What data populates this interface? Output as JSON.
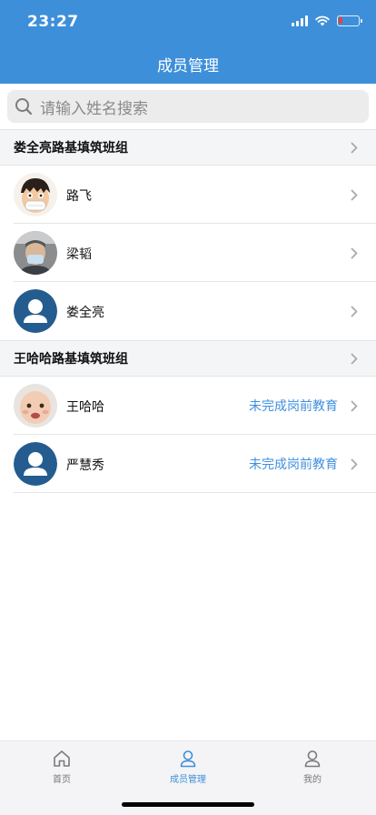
{
  "status_bar": {
    "time": "23:27",
    "battery_level": 0.15,
    "battery_color": "#e4453a"
  },
  "header": {
    "title": "成员管理",
    "background": "#3d8fd9"
  },
  "search": {
    "placeholder": "请输入姓名搜索",
    "icon": "search-icon"
  },
  "groups": [
    {
      "title": "娄全亮路基填筑班组",
      "members": [
        {
          "name": "路飞",
          "avatar": "cartoon-face",
          "status": ""
        },
        {
          "name": "梁韬",
          "avatar": "masked-person-photo",
          "status": ""
        },
        {
          "name": "娄全亮",
          "avatar": "default-avatar",
          "status": ""
        }
      ]
    },
    {
      "title": "王哈哈路基填筑班组",
      "members": [
        {
          "name": "王哈哈",
          "avatar": "baby-photo",
          "status": "未完成岗前教育"
        },
        {
          "name": "严慧秀",
          "avatar": "default-avatar",
          "status": "未完成岗前教育"
        }
      ]
    }
  ],
  "tabbar": {
    "active": "members",
    "items": [
      {
        "label": "首页",
        "icon": "home-icon"
      },
      {
        "label": "成员管理",
        "icon": "person-icon"
      },
      {
        "label": "我的",
        "icon": "profile-icon"
      }
    ]
  },
  "colors": {
    "accent": "#3d8fd9",
    "status_text": "#3f8fde"
  }
}
